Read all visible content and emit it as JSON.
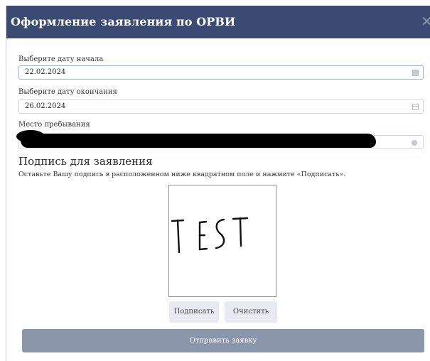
{
  "dialog": {
    "title": "Оформление заявления по ОРВИ",
    "close_icon": "close-icon"
  },
  "form": {
    "start_date": {
      "label": "Выберите дату начала",
      "value": "22.02.2024",
      "icon": "calendar-icon"
    },
    "end_date": {
      "label": "Выберите дату окончания",
      "value": "26.02.2024",
      "icon": "calendar-icon"
    },
    "location": {
      "label": "Место пребывания",
      "value": "",
      "icon": "clear-icon"
    }
  },
  "signature": {
    "heading": "Подпись для заявления",
    "hint": "Оставьте Вашу подпись в расположенном ниже квадратном поле и нажмите «Подписать».",
    "drawn_text": "TEST",
    "sign_label": "Подписать",
    "clear_label": "Очистить"
  },
  "submit_label": "Отправить заявку",
  "colors": {
    "header_bg": "#3a4a73",
    "submit_bg": "#8a96aa",
    "button_bg": "#e7eaf0"
  }
}
